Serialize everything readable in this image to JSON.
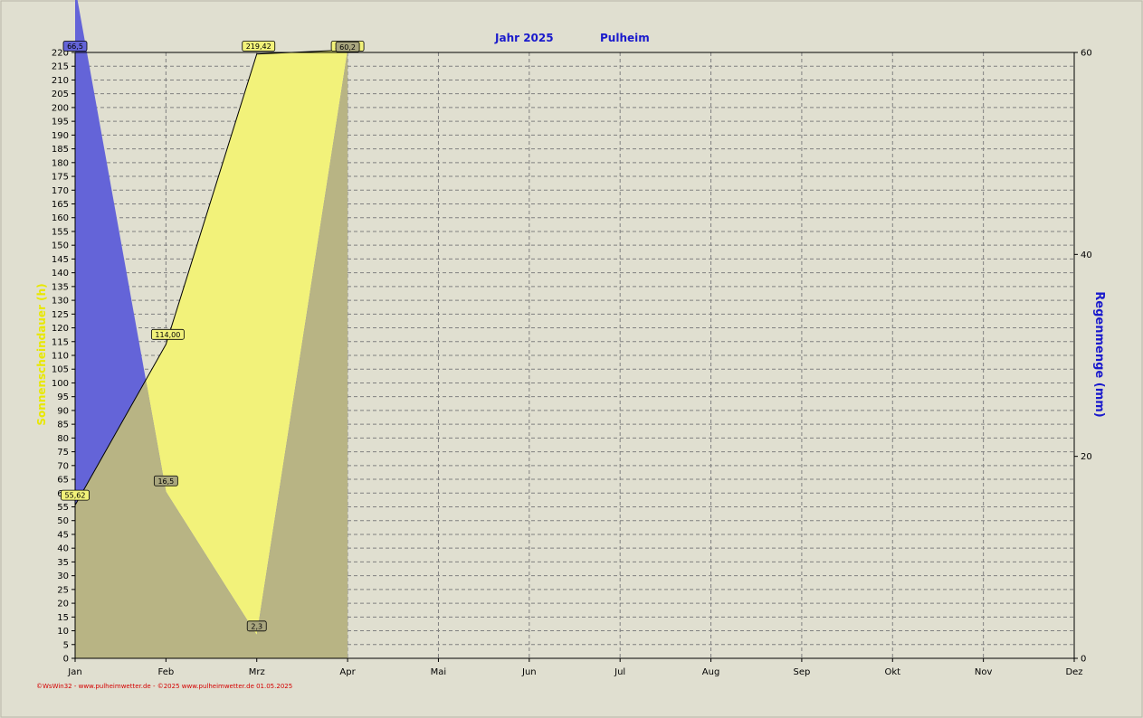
{
  "header": {
    "title_left": "Jahr  2025",
    "title_right": "Pulheim"
  },
  "footer": {
    "text": "©WsWin32 - www.pulheimwetter.de - ©2025 www.pulheimwetter.de  01.05.2025"
  },
  "colors": {
    "background": "#e0dfd0",
    "sunshine_fill": "#f2f27a",
    "rain_fill": "#6464d8",
    "overlap_fill": "#b8b484",
    "grid": "#808080"
  },
  "chart_data": {
    "type": "area",
    "title": "Jahr  2025    Pulheim",
    "categories": [
      "Jan",
      "Feb",
      "Mrz",
      "Apr",
      "Mai",
      "Jun",
      "Jul",
      "Aug",
      "Sep",
      "Okt",
      "Nov",
      "Dez"
    ],
    "ylabel_left": "Sonnenscheindauer  (h)",
    "ylabel_right": "Regenmenge  (mm)",
    "ylim_left": [
      0,
      220
    ],
    "ylim_right": [
      0,
      60
    ],
    "yticks_left": [
      0,
      5,
      10,
      15,
      20,
      25,
      30,
      35,
      40,
      45,
      50,
      55,
      60,
      65,
      70,
      75,
      80,
      85,
      90,
      95,
      100,
      105,
      110,
      115,
      120,
      125,
      130,
      135,
      140,
      145,
      150,
      155,
      160,
      165,
      170,
      175,
      180,
      185,
      190,
      195,
      200,
      205,
      210,
      215,
      220
    ],
    "yticks_right": [
      0,
      20,
      40,
      60
    ],
    "grid": true,
    "series": [
      {
        "name": "Sonnenscheindauer",
        "axis": "left",
        "color": "#f2f27a",
        "values": [
          55.62,
          114.0,
          219.42,
          220.92
        ],
        "labels": [
          "55,62",
          "114,00",
          "219,42",
          "220,92"
        ]
      },
      {
        "name": "Regenmenge",
        "axis": "right",
        "color": "#6464d8",
        "values": [
          66.5,
          16.5,
          2.3,
          60.2
        ],
        "labels": [
          "66,5",
          "16,5",
          "2,3",
          "60,2"
        ]
      }
    ]
  }
}
